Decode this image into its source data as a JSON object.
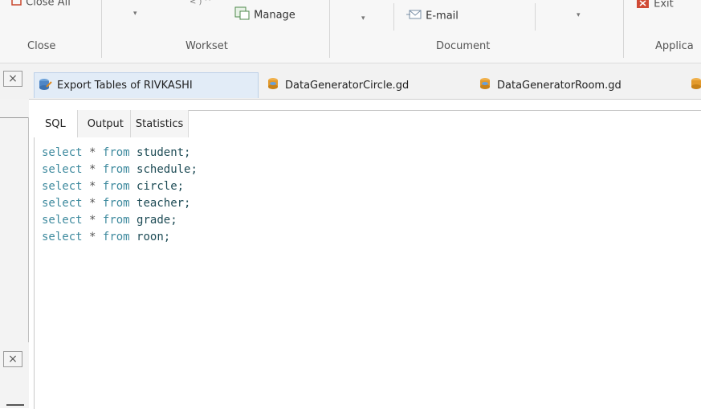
{
  "ribbon": {
    "close_all_label": "Close All",
    "manage_label": "Manage",
    "email_label": "E-mail",
    "exit_label": "Exit",
    "groups": {
      "close": "Close",
      "workset": "Workset",
      "document": "Document",
      "application": "Applica"
    }
  },
  "doc_tabs": [
    {
      "label": "Export Tables of RIVKASHI",
      "icon": "export-icon",
      "active": true
    },
    {
      "label": "DataGeneratorCircle.gd",
      "icon": "data-generator-icon",
      "active": false
    },
    {
      "label": "DataGeneratorRoom.gd",
      "icon": "data-generator-icon",
      "active": false
    }
  ],
  "left_panel": {
    "close_symbol": "×"
  },
  "editor": {
    "tabs": [
      {
        "label": "SQL",
        "active": true
      },
      {
        "label": "Output",
        "active": false
      },
      {
        "label": "Statistics",
        "active": false
      }
    ],
    "code_lines": [
      {
        "keyword1": "select",
        "star": "*",
        "keyword2": "from",
        "table": "student;"
      },
      {
        "keyword1": "select",
        "star": "*",
        "keyword2": "from",
        "table": "schedule;"
      },
      {
        "keyword1": "select",
        "star": "*",
        "keyword2": "from",
        "table": "circle;"
      },
      {
        "keyword1": "select",
        "star": "*",
        "keyword2": "from",
        "table": "teacher;"
      },
      {
        "keyword1": "select",
        "star": "*",
        "keyword2": "from",
        "table": "grade;"
      },
      {
        "keyword1": "select",
        "star": "*",
        "keyword2": "from",
        "table": "roon;"
      }
    ]
  },
  "colors": {
    "keyword": "#3e8a9e",
    "identifier": "#1d4b55",
    "active_tab": "#e2ecf7"
  }
}
